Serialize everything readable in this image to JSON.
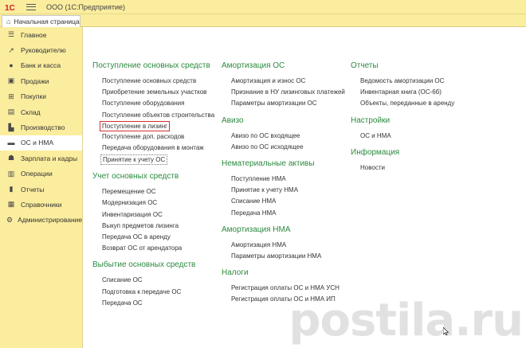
{
  "titlebar": {
    "logo_text": "1С",
    "app_title": "ООО  (1С:Предприятие)"
  },
  "tabs": {
    "home_label": "Начальная страница"
  },
  "sidebar": {
    "items": [
      {
        "label": "Главное",
        "icon": "list-icon"
      },
      {
        "label": "Руководителю",
        "icon": "trend-icon"
      },
      {
        "label": "Банк и касса",
        "icon": "coins-icon"
      },
      {
        "label": "Продажи",
        "icon": "bag-icon"
      },
      {
        "label": "Покупки",
        "icon": "cart-icon"
      },
      {
        "label": "Склад",
        "icon": "box-icon"
      },
      {
        "label": "Производство",
        "icon": "factory-icon"
      },
      {
        "label": "ОС и НМА",
        "icon": "truck-icon"
      },
      {
        "label": "Зарплата и кадры",
        "icon": "person-icon"
      },
      {
        "label": "Операции",
        "icon": "operations-icon"
      },
      {
        "label": "Отчеты",
        "icon": "chart-icon"
      },
      {
        "label": "Справочники",
        "icon": "book-icon"
      },
      {
        "label": "Администрирование",
        "icon": "gear-icon"
      }
    ],
    "active_index": 7
  },
  "main": {
    "columns": [
      {
        "sections": [
          {
            "title": "Поступление основных средств",
            "links": [
              "Поступление основных средств",
              "Приобретение земельных участков",
              "Поступление оборудования",
              "Поступление объектов строительства",
              "Поступление в лизинг",
              "Поступление доп. расходов",
              "Передача оборудования в монтаж",
              "Принятие к учету ОС"
            ]
          },
          {
            "title": "Учет основных средств",
            "links": [
              "Перемещение ОС",
              "Модернизация ОС",
              "Инвентаризация ОС",
              "Выкуп предметов лизинга",
              "Передача ОС в аренду",
              "Возврат ОС от арендатора"
            ]
          },
          {
            "title": "Выбытие основных средств",
            "links": [
              "Списание ОС",
              "Подготовка к передаче ОС",
              "Передача ОС"
            ]
          }
        ]
      },
      {
        "sections": [
          {
            "title": "Амортизация ОС",
            "links": [
              "Амортизация и износ ОС",
              "Признание в НУ лизинговых платежей",
              "Параметры амортизации ОС"
            ]
          },
          {
            "title": "Авизо",
            "links": [
              "Авизо по ОС входящее",
              "Авизо по ОС исходящее"
            ]
          },
          {
            "title": "Нематериальные активы",
            "links": [
              "Поступление НМА",
              "Принятие к учету НМА",
              "Списание НМА",
              "Передача НМА"
            ]
          },
          {
            "title": "Амортизация НМА",
            "links": [
              "Амортизация НМА",
              "Параметры амортизации НМА"
            ]
          },
          {
            "title": "Налоги",
            "links": [
              "Регистрация оплаты ОС и НМА УСН",
              "Регистрация оплаты ОС и НМА ИП"
            ]
          }
        ]
      },
      {
        "sections": [
          {
            "title": "Отчеты",
            "links": [
              "Ведомость амортизации ОС",
              "Инвентарная книга (ОС-6б)",
              "Объекты, переданные в аренду"
            ]
          },
          {
            "title": "Настройки",
            "links": [
              "ОС и НМА"
            ]
          },
          {
            "title": "Информация",
            "links": [
              "Новости"
            ]
          }
        ]
      }
    ]
  },
  "watermark": "postila.ru",
  "colors": {
    "panel": "#fbed9e",
    "section_title": "#2b8a3e",
    "highlight": "#d32f2f"
  }
}
